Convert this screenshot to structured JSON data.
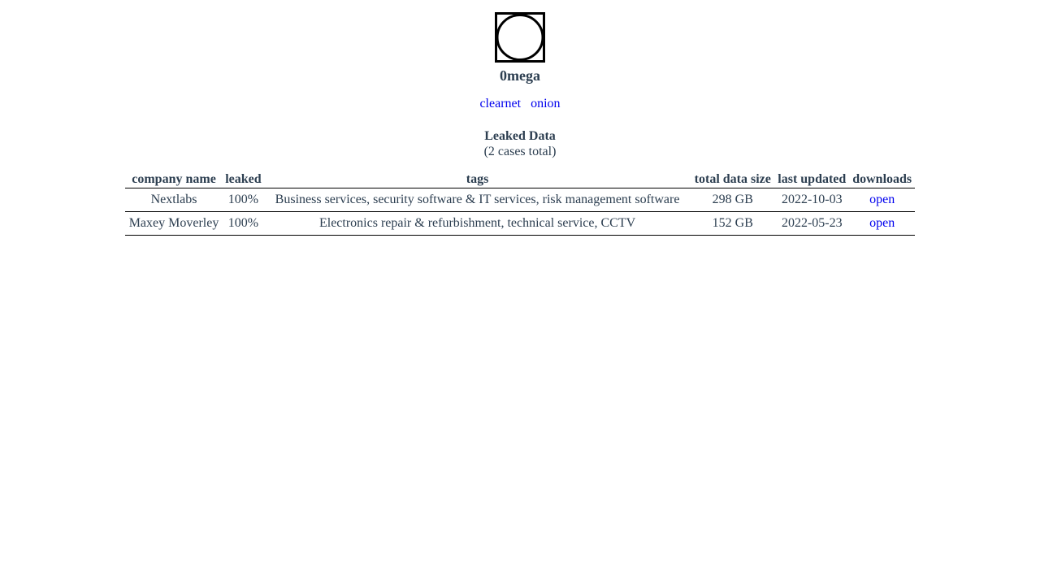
{
  "brand": {
    "logo_icon": "omega-logo-icon",
    "name": "0mega"
  },
  "nav": {
    "links": [
      {
        "label": "clearnet"
      },
      {
        "label": "onion"
      }
    ]
  },
  "section": {
    "title": "Leaked Data",
    "subtitle": "(2 cases total)"
  },
  "table": {
    "headers": [
      "company name",
      "leaked",
      "tags",
      "total data size",
      "last updated",
      "downloads"
    ],
    "rows": [
      {
        "company": "Nextlabs",
        "leaked": "100%",
        "tags": "Business services, security software & IT services, risk management software",
        "size": "298 GB",
        "updated": "2022-10-03",
        "download": "open"
      },
      {
        "company": "Maxey Moverley",
        "leaked": "100%",
        "tags": "Electronics repair & refurbishment, technical service, CCTV",
        "size": "152 GB",
        "updated": "2022-05-23",
        "download": "open"
      }
    ]
  },
  "colors": {
    "text": "#2c3e50",
    "link": "#0000ee",
    "border": "#000000"
  }
}
